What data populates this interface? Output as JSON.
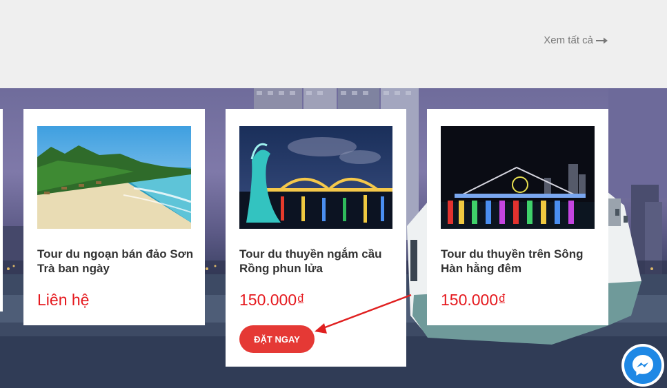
{
  "header": {
    "see_all_label": "Xem tất cả",
    "see_all_icon": "arrow-right-icon"
  },
  "tours": [
    {
      "title": "Tour du ngoạn bán đảo Sơn Trà ban ngày",
      "price": "Liên hệ",
      "image": "beach-photo"
    },
    {
      "title": "Tour du thuyền ngắm cầu Rồng phun lửa",
      "price": "150.000₫",
      "image": "dragon-bridge-night-photo",
      "book_label": "ĐẶT NGAY"
    },
    {
      "title": "Tour du thuyền trên Sông Hàn hằng đêm",
      "price": "150.000₫",
      "image": "han-river-night-photo"
    }
  ],
  "colors": {
    "price": "#e5191e",
    "button": "#e53935",
    "messenger": "#1e88e5",
    "annotation_arrow": "#e02020"
  },
  "messenger": {
    "icon": "messenger-icon"
  }
}
